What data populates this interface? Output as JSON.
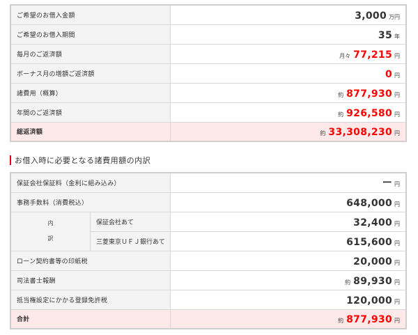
{
  "summary": {
    "rows": [
      {
        "label": "ご希望のお借入金額",
        "prefix": "",
        "value": "3,000",
        "unit": "万円",
        "red": false
      },
      {
        "label": "ご希望のお借入期間",
        "prefix": "",
        "value": "35",
        "unit": "年",
        "red": false
      },
      {
        "label": "毎月のご返済額",
        "prefix": "月々",
        "value": "77,215",
        "unit": "円",
        "red": true
      },
      {
        "label": "ボーナス月の増額ご返済額",
        "prefix": "",
        "value": "0",
        "unit": "円",
        "red": true
      },
      {
        "label": "諸費用（概算）",
        "prefix": "約",
        "value": "877,930",
        "unit": "円",
        "red": true
      },
      {
        "label": "年間のご返済額",
        "prefix": "約",
        "value": "926,580",
        "unit": "円",
        "red": true
      }
    ],
    "total": {
      "label": "総返済額",
      "prefix": "約",
      "value": "33,308,230",
      "unit": "円"
    }
  },
  "costs": {
    "heading": "お借入時に必要となる諸費用額の内訳",
    "guarantee_fee": {
      "label": "保証会社保証料（金利に組み込み）",
      "value": "ー",
      "unit": "円"
    },
    "admin_fee": {
      "label": "事務手数料（消費税込）",
      "value": "648,000",
      "unit": "円"
    },
    "breakdown": {
      "mark_top": "内",
      "mark_bottom": "訳",
      "items": [
        {
          "label": "保証会社あて",
          "value": "32,400",
          "unit": "円"
        },
        {
          "label": "三菱東京ＵＦＪ銀行あて",
          "value": "615,600",
          "unit": "円"
        }
      ]
    },
    "stamp_tax": {
      "label": "ローン契約書等の印紙税",
      "value": "20,000",
      "unit": "円"
    },
    "scrivener_fee": {
      "label": "司法書士報酬",
      "prefix": "約",
      "value": "89,930",
      "unit": "円"
    },
    "registration_tax": {
      "label": "抵当権設定にかかる登録免許税",
      "value": "120,000",
      "unit": "円"
    },
    "total": {
      "label": "合計",
      "prefix": "約",
      "value": "877,930",
      "unit": "円"
    }
  },
  "colors": {
    "accent_red": "#ff0000",
    "total_bg": "#fde9ea",
    "label_bg": "#f4f4f4"
  }
}
